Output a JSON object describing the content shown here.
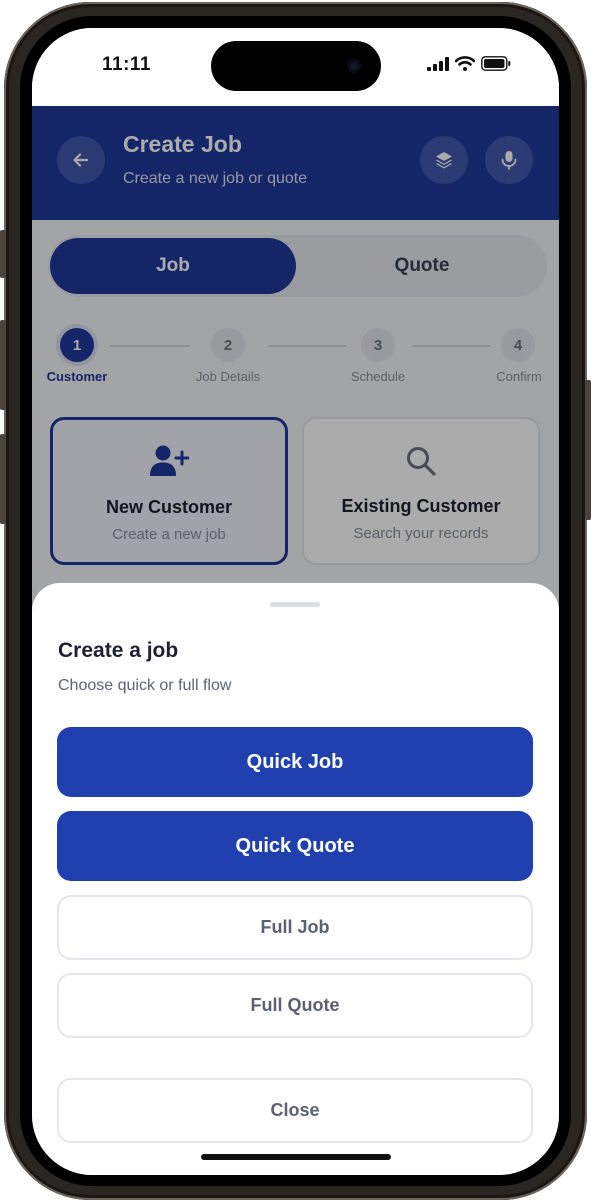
{
  "status_bar": {
    "time": "11:11"
  },
  "header": {
    "title": "Create Job",
    "subtitle": "Create a new job or quote",
    "icons": {
      "back": "arrow-left-icon",
      "layers": "layers-icon",
      "mic": "microphone-icon"
    },
    "color": "#1e3a9c"
  },
  "segmented": {
    "options": [
      "Job",
      "Quote"
    ],
    "selected": "Job"
  },
  "stepper": {
    "steps": [
      {
        "number": "1",
        "label": "Customer"
      },
      {
        "number": "2",
        "label": "Job Details"
      },
      {
        "number": "3",
        "label": "Schedule"
      },
      {
        "number": "4",
        "label": "Confirm"
      }
    ],
    "current_step": 1
  },
  "customer_cards": [
    {
      "title": "New Customer",
      "subtitle": "Create a new job",
      "icon": "add-user-icon",
      "selected": true
    },
    {
      "title": "Existing Customer",
      "subtitle": "Search your records",
      "icon": "search-icon",
      "selected": false
    }
  ],
  "sheet": {
    "title": "Create a job",
    "subtitle": "Choose quick or full flow",
    "primary_buttons": [
      "Quick Job",
      "Quick Quote"
    ],
    "secondary_buttons": [
      "Full Job",
      "Full Quote"
    ],
    "close_label": "Close",
    "accent": "#2040b0"
  }
}
